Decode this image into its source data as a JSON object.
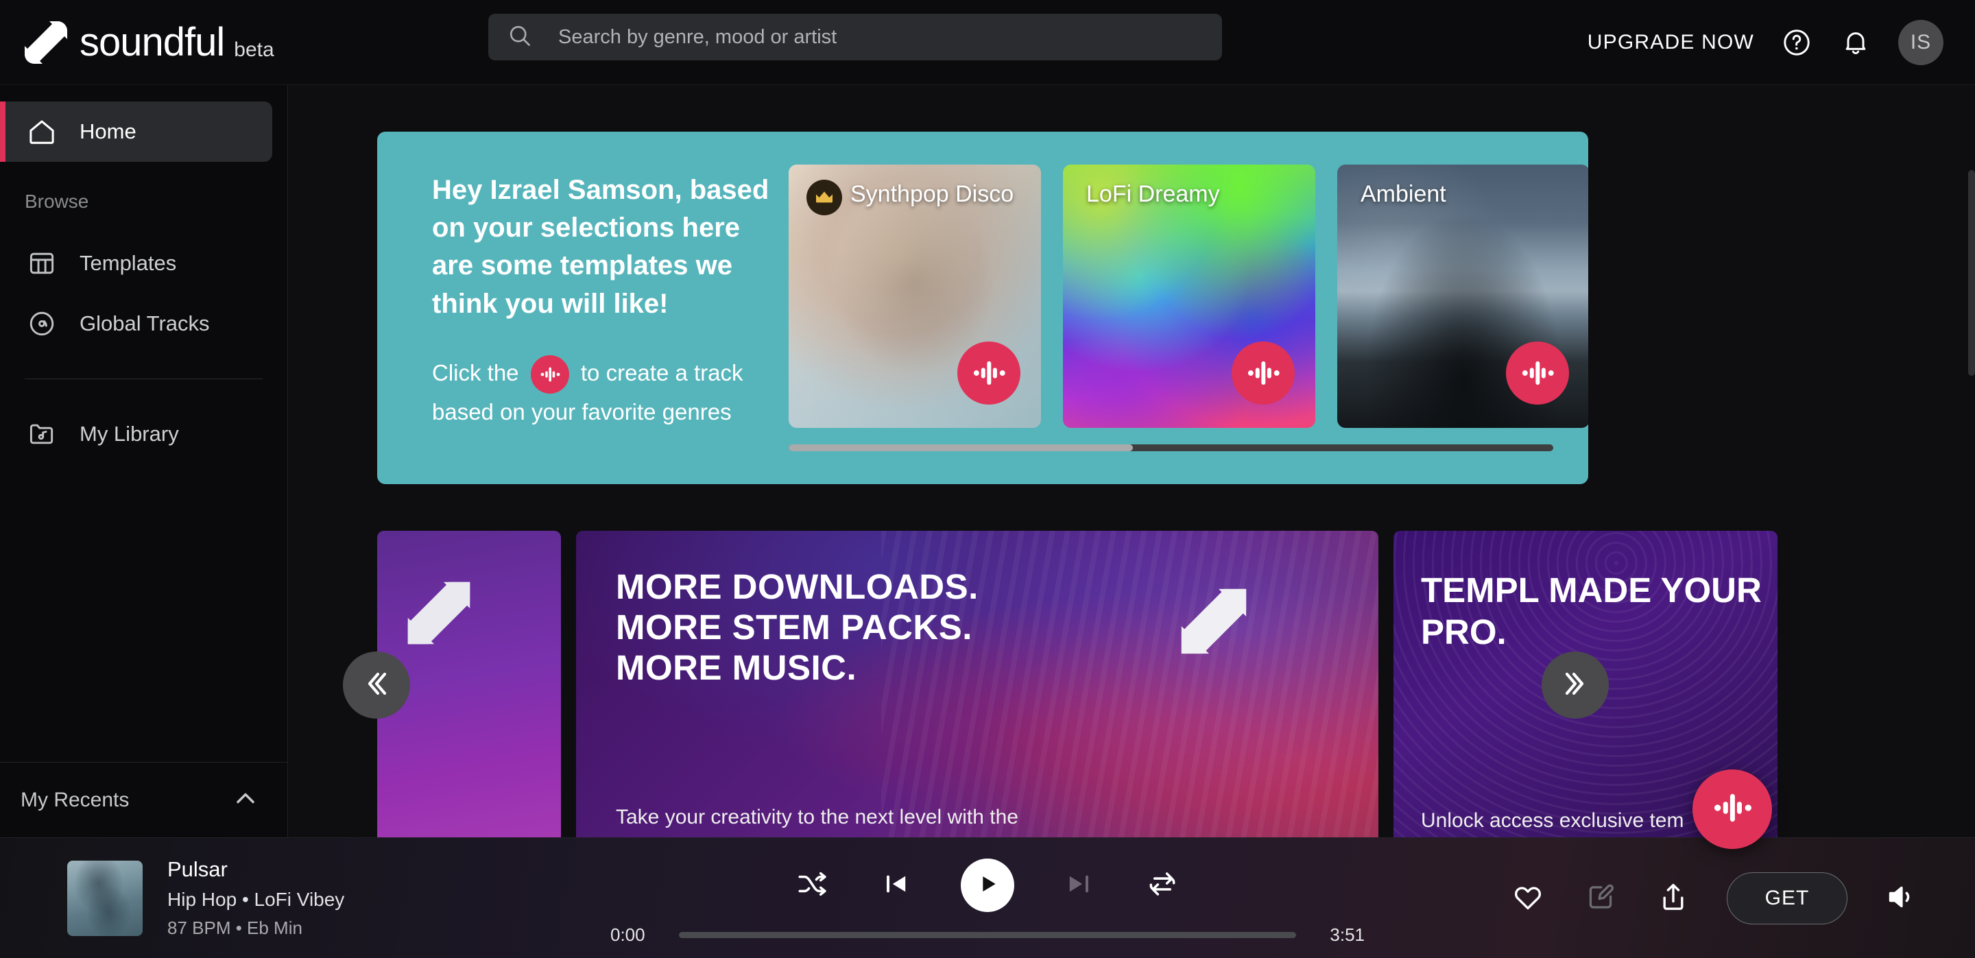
{
  "header": {
    "logo_text": "soundful",
    "logo_beta": "beta",
    "logo_icon": "soundful-logo-mark",
    "search": {
      "placeholder": "Search by genre, mood or artist",
      "value": "",
      "icon": "search-icon"
    },
    "upgrade_label": "UPGRADE NOW",
    "help_icon": "help-circle-icon",
    "notification_icon": "bell-icon",
    "avatar_initials": "IS"
  },
  "sidebar": {
    "primary": [
      {
        "label": "Home",
        "icon": "home-icon",
        "active": true
      }
    ],
    "browse_title": "Browse",
    "browse": [
      {
        "label": "Templates",
        "icon": "grid-table-icon",
        "active": false
      },
      {
        "label": "Global Tracks",
        "icon": "disc-icon",
        "active": false
      }
    ],
    "library": [
      {
        "label": "My Library",
        "icon": "folder-music-icon",
        "active": false
      }
    ],
    "recents": {
      "label": "My Recents",
      "chevron_icon": "chevron-up-icon"
    }
  },
  "banner": {
    "background_color": "#56b5bb",
    "heading": "Hey Izrael Samson, based on your selections here are some templates we think you will like!",
    "sub_before": "Click the",
    "sub_after": "to create a track based on your favorite genres",
    "inline_icon": "waveform-icon",
    "accent_color": "#e03258",
    "templates": [
      {
        "title": "Synthpop Disco",
        "premium": true,
        "crown_icon": "crown-icon",
        "create_icon": "waveform-icon",
        "art": "synthpop-photo"
      },
      {
        "title": "LoFi Dreamy",
        "premium": false,
        "crown_icon": "",
        "create_icon": "waveform-icon",
        "art": "gradient-art"
      },
      {
        "title": "Ambient",
        "premium": false,
        "crown_icon": "",
        "create_icon": "waveform-icon",
        "art": "seascape-photo"
      }
    ],
    "scrollbar_percent": 45
  },
  "promos": {
    "prev_icon": "chevron-double-left-icon",
    "next_icon": "chevron-double-right-icon",
    "left_card": {
      "logo_icon": "soundful-logo-mark"
    },
    "main_card": {
      "heading": "MORE DOWNLOADS. MORE STEM PACKS. MORE MUSIC.",
      "subtitle": "Take your creativity to the next level with the",
      "logo_icon": "soundful-logo-mark"
    },
    "right_card": {
      "heading": "TEMPL MADE YOUR PRO.",
      "subtitle": "Unlock access exclusive tem"
    }
  },
  "fab": {
    "icon": "waveform-icon",
    "color": "#e03258"
  },
  "player": {
    "track_title": "Pulsar",
    "track_genre": "Hip Hop • LoFi Vibey",
    "track_bpm": "87 BPM • Eb Min",
    "artwork": "pulsar-cover",
    "controls": {
      "shuffle_icon": "shuffle-icon",
      "previous_icon": "skip-previous-icon",
      "play_icon": "play-icon",
      "next_icon": "skip-next-icon",
      "repeat_icon": "repeat-icon"
    },
    "current_time": "0:00",
    "total_time": "3:51",
    "progress_percent": 0,
    "actions": {
      "favorite_icon": "heart-icon",
      "edit_icon": "edit-pencil-icon",
      "share_icon": "share-upload-icon",
      "get_label": "GET",
      "volume_icon": "volume-icon"
    }
  }
}
